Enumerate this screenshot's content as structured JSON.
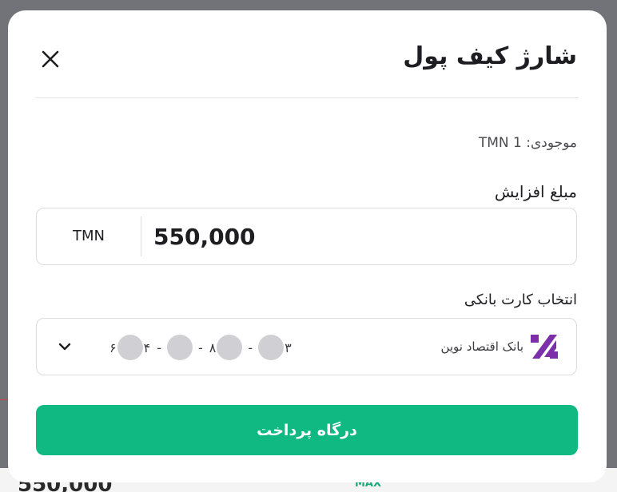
{
  "modal": {
    "title": "شارژ کیف پول",
    "balance_text": "موجودی: TMN 1",
    "amount": {
      "label": "مبلغ افزایش",
      "currency": "TMN",
      "value": "550,000"
    },
    "card": {
      "label": "انتخاب کارت بانکی",
      "bank_name": "بانک اقتصاد نوین",
      "bank_logo_color": "#7b2fa8",
      "number_parts": {
        "d1": "۶",
        "d2": "۴",
        "d3": "۸",
        "d4": "۳"
      }
    },
    "pay_button_label": "درگاه پرداخت",
    "accent_color": "#10b981"
  },
  "background": {
    "amount_text": "550,000",
    "max_label": "MAX"
  }
}
